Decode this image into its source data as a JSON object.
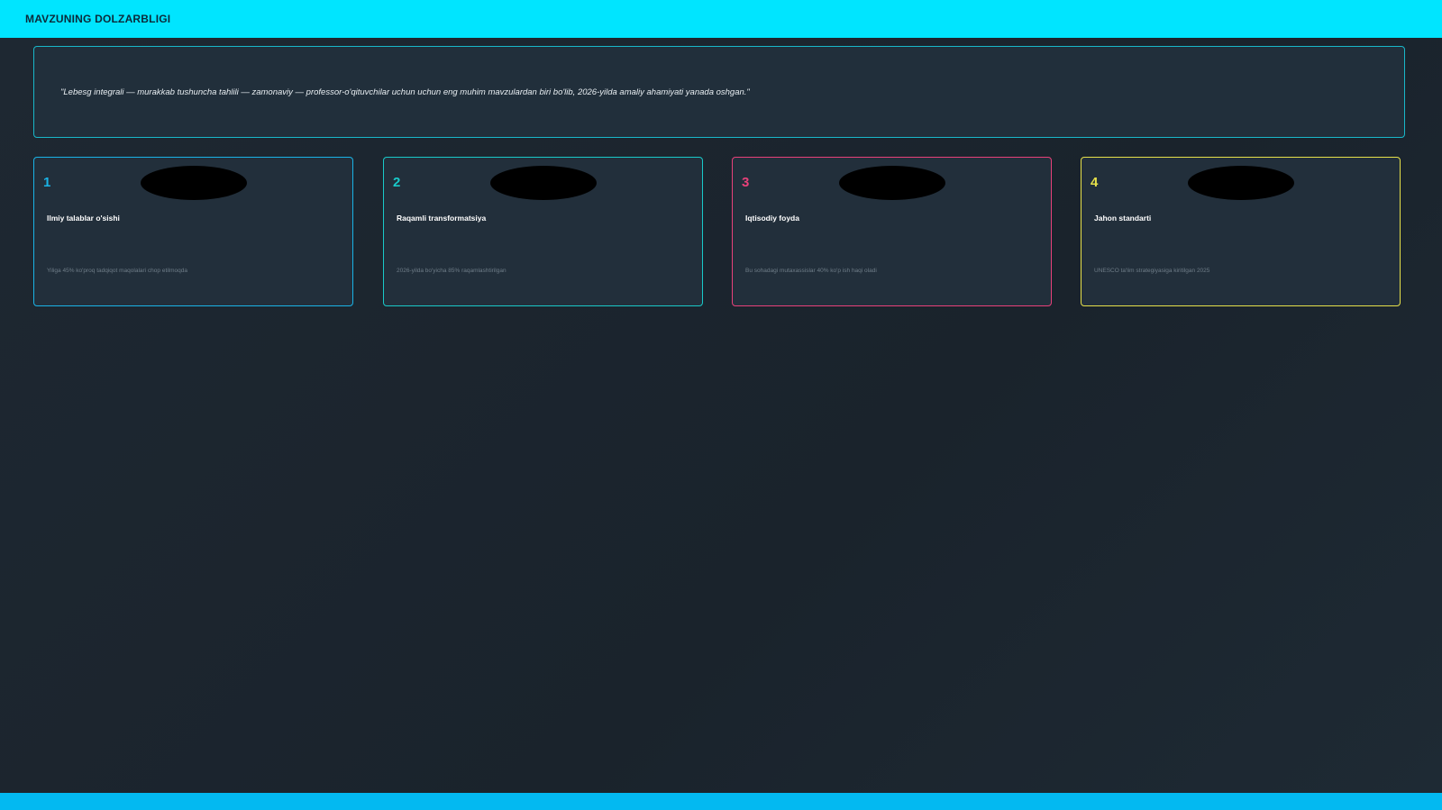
{
  "header": {
    "title": "MAVZUNING DOLZARBLIGI"
  },
  "quote": {
    "text": "\"Lebesg integrali — murakkab tushuncha tahlili — zamonaviy — professor-o'qituvchilar uchun uchun eng muhim mavzulardan biri bo'lib, 2026-yilda amaliy ahamiyati yanada oshgan.\""
  },
  "cards": [
    {
      "number": "1",
      "title": "Ilmiy talablar o'sishi",
      "description": "Yiliga 45% ko'proq tadqiqot maqolalari chop etilmoqda",
      "color": "#1ab3e6"
    },
    {
      "number": "2",
      "title": "Raqamli transformatsiya",
      "description": "2026-yilda bo'yicha 85% raqamlashtirilgan",
      "color": "#19c9c9"
    },
    {
      "number": "3",
      "title": "Iqtisodiy foyda",
      "description": "Bu sohadagi mutaxassislar 40% ko'p ish haqi oladi",
      "color": "#e8417a"
    },
    {
      "number": "4",
      "title": "Jahon standarti",
      "description": "UNESCO ta'lim strategiyasiga kiritilgan 2025",
      "color": "#e6e04a"
    }
  ],
  "footer": {}
}
